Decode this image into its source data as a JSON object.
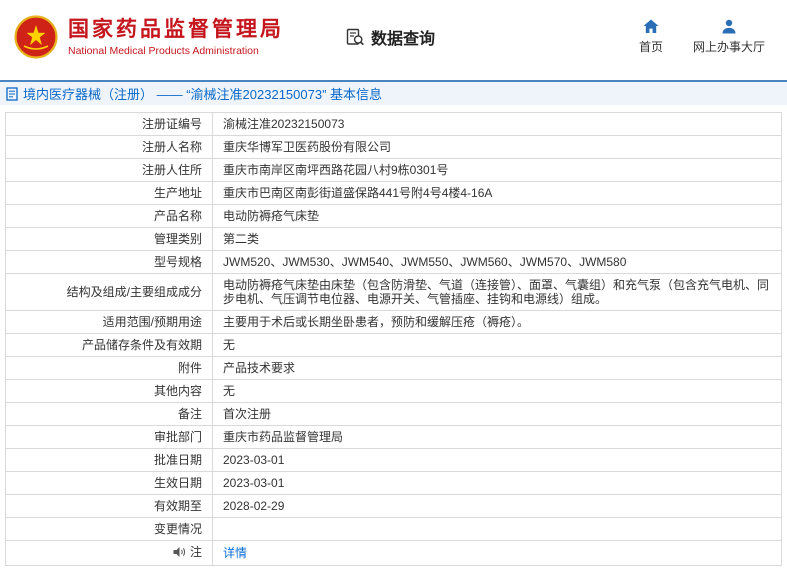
{
  "colors": {
    "brand_red": "#c5161d",
    "icon_blue": "#2a6fb5",
    "title_blue": "#0a68c8",
    "link_blue": "#0a6cd6",
    "titlebar_bg": "#eef4fa",
    "table_border": "#d9d9d9"
  },
  "header": {
    "agency_cn": "国家药品监督管理局",
    "agency_en": "National Medical Products Administration",
    "nav_query": "数据查询",
    "nav_home": "首页",
    "nav_hall": "网上办事大厅"
  },
  "title_bar": {
    "text": "境内医疗器械（注册） —— “渝械注准20232150073” 基本信息"
  },
  "table": {
    "rows": [
      {
        "label": "注册证编号",
        "value": "渝械注准20232150073"
      },
      {
        "label": "注册人名称",
        "value": "重庆华博军卫医药股份有限公司"
      },
      {
        "label": "注册人住所",
        "value": "重庆市南岸区南坪西路花园八村9栋0301号"
      },
      {
        "label": "生产地址",
        "value": "重庆市巴南区南彭街道盛保路441号附4号4楼4-16A"
      },
      {
        "label": "产品名称",
        "value": "电动防褥疮气床垫"
      },
      {
        "label": "管理类别",
        "value": "第二类"
      },
      {
        "label": "型号规格",
        "value": "JWM520、JWM530、JWM540、JWM550、JWM560、JWM570、JWM580"
      },
      {
        "label": "结构及组成/主要组成成分",
        "value": "电动防褥疮气床垫由床垫（包含防滑垫、气道（连接管）、面罩、气囊组）和充气泵（包含充气电机、同步电机、气压调节电位器、电源开关、气管插座、挂钩和电源线）组成。"
      },
      {
        "label": "适用范围/预期用途",
        "value": "主要用于术后或长期坐卧患者，预防和缓解压疮（褥疮）。"
      },
      {
        "label": "产品储存条件及有效期",
        "value": "无"
      },
      {
        "label": "附件",
        "value": "产品技术要求"
      },
      {
        "label": "其他内容",
        "value": "无"
      },
      {
        "label": "备注",
        "value": "首次注册"
      },
      {
        "label": "审批部门",
        "value": "重庆市药品监督管理局"
      },
      {
        "label": "批准日期",
        "value": "2023-03-01"
      },
      {
        "label": "生效日期",
        "value": "2023-03-01"
      },
      {
        "label": "有效期至",
        "value": "2028-02-29"
      },
      {
        "label": "变更情况",
        "value": ""
      },
      {
        "label": "注",
        "value": "详情"
      }
    ]
  }
}
